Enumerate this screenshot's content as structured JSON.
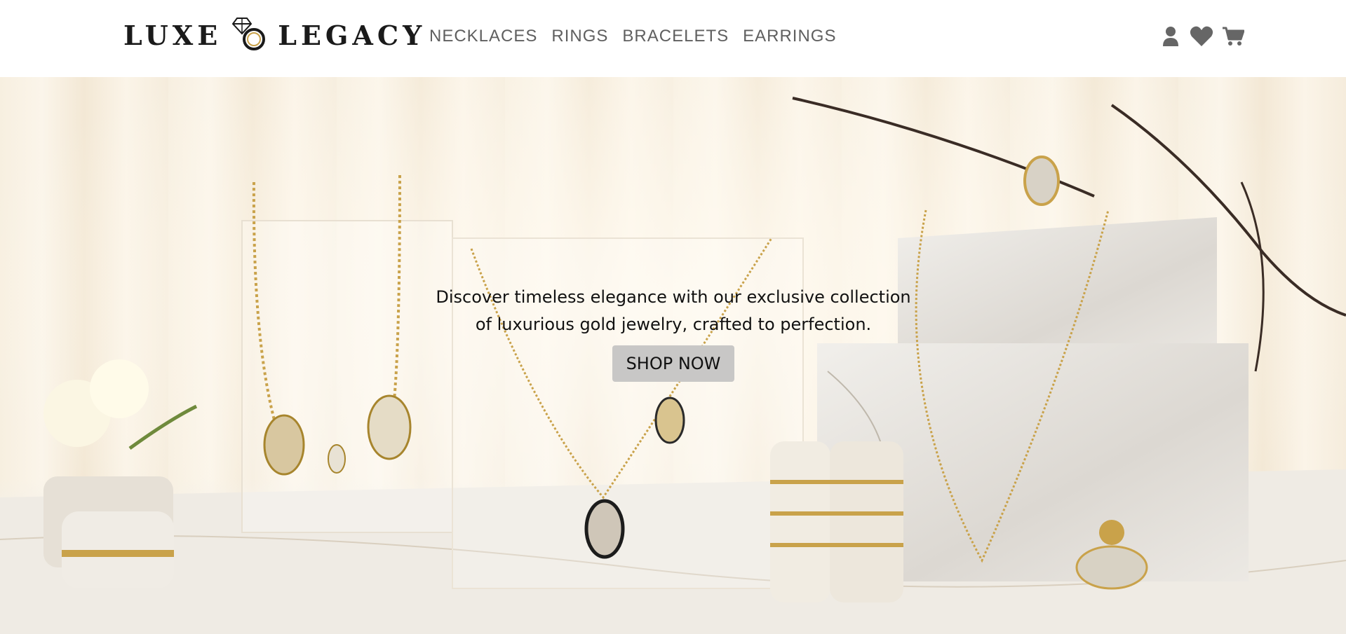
{
  "brand": {
    "name_left": "LUXE",
    "name_right": "LEGACY",
    "logo_icon": "diamond-ring-icon"
  },
  "nav": {
    "items": [
      {
        "label": "NECKLACES"
      },
      {
        "label": "RINGS"
      },
      {
        "label": "BRACELETS"
      },
      {
        "label": "EARRINGS"
      }
    ]
  },
  "header_icons": {
    "account": "user-icon",
    "wishlist": "heart-icon",
    "cart": "cart-icon",
    "color": "#666666"
  },
  "hero": {
    "tagline_line1": "Discover timeless elegance with our exclusive collection",
    "tagline_line2": "of luxurious gold jewelry, crafted to perfection.",
    "cta_label": "SHOP NOW",
    "cta_bg": "#c8c7c6"
  },
  "colors": {
    "gold": "#c9a24a",
    "marble": "#e9e6e1",
    "text": "#111111"
  }
}
